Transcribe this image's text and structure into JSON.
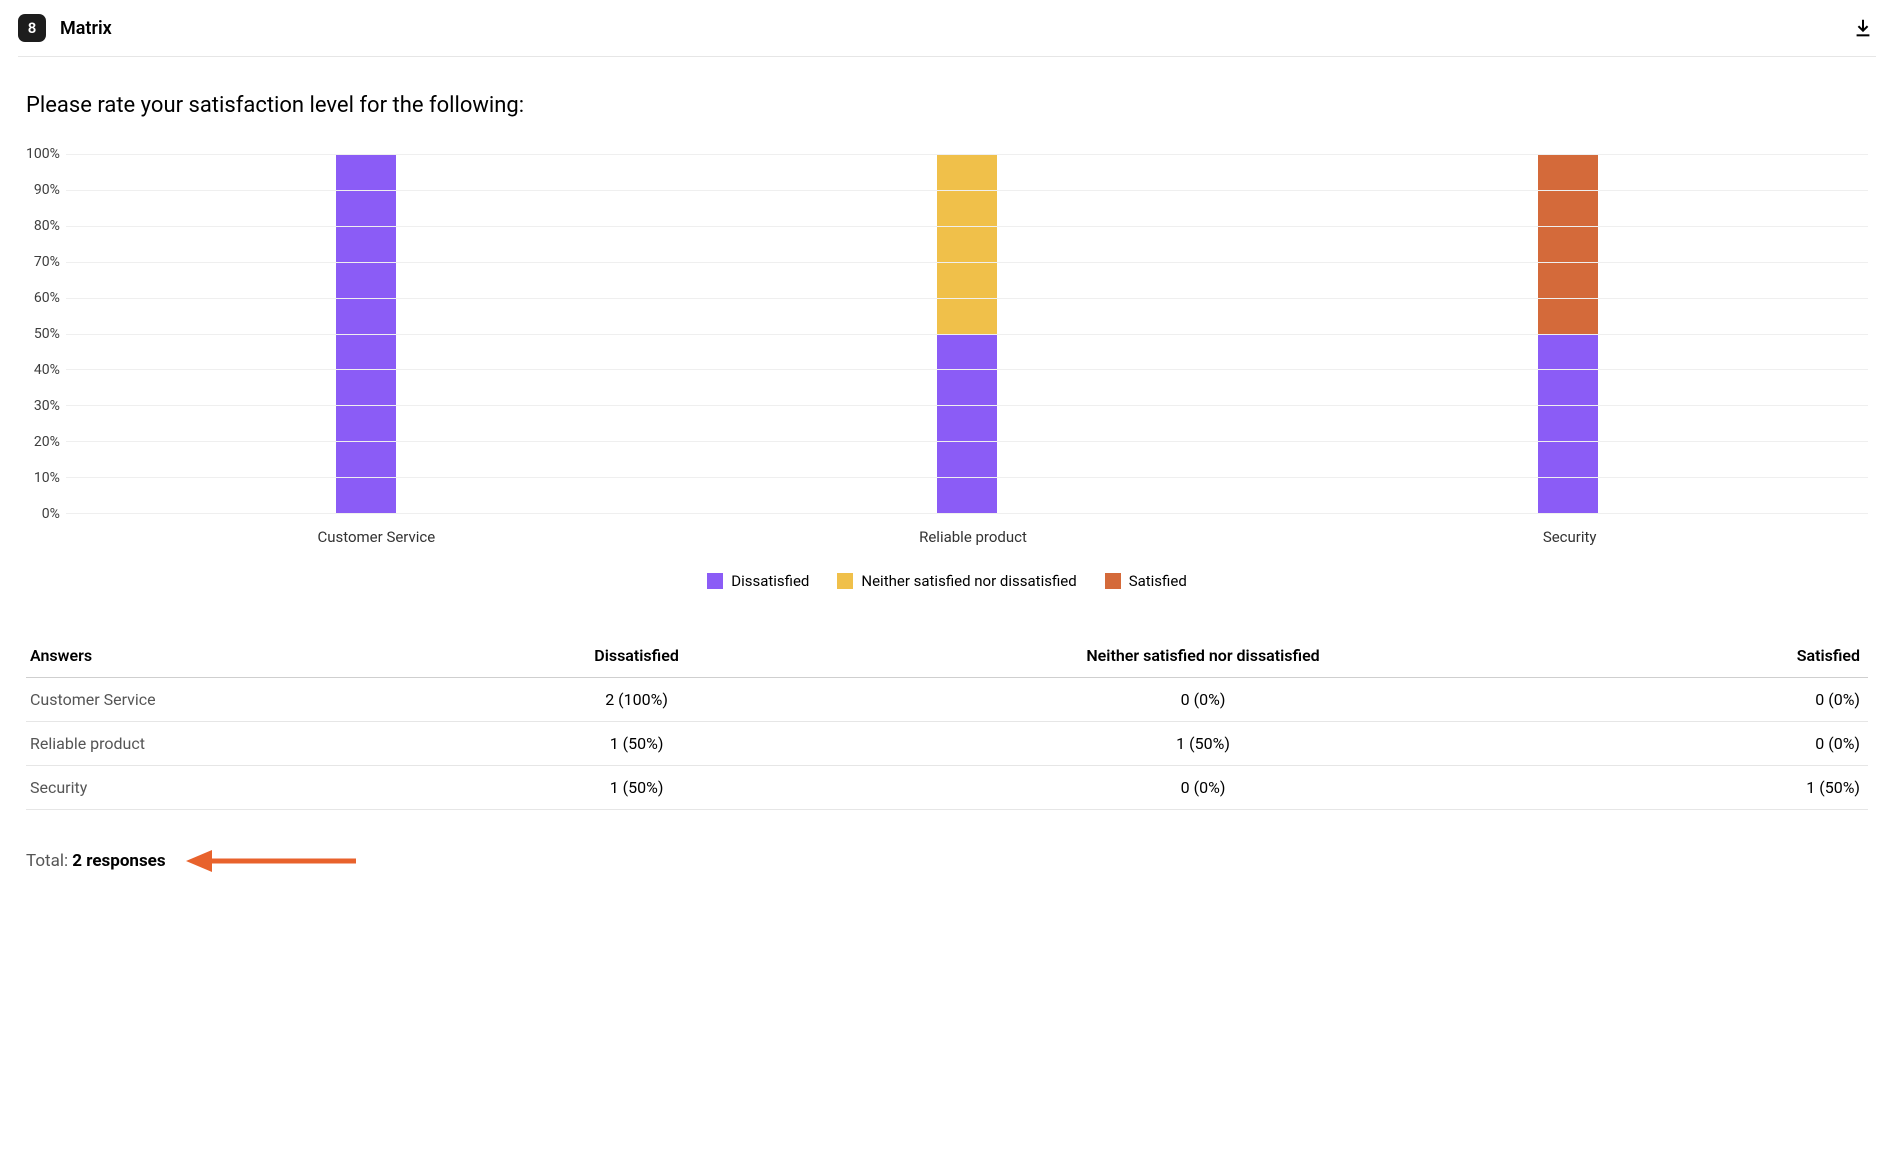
{
  "header": {
    "question_number": "8",
    "question_type": "Matrix"
  },
  "question": {
    "title": "Please rate your satisfaction level for the following:"
  },
  "chart_data": {
    "type": "bar",
    "stacked": true,
    "ylabel": "",
    "xlabel": "",
    "ylim": [
      0,
      100
    ],
    "y_ticks": [
      "100%",
      "90%",
      "80%",
      "70%",
      "60%",
      "50%",
      "40%",
      "30%",
      "20%",
      "10%",
      "0%"
    ],
    "categories": [
      "Customer Service",
      "Reliable product",
      "Security"
    ],
    "series": [
      {
        "name": "Dissatisfied",
        "color": "#8b5cf6",
        "values": [
          100,
          50,
          50
        ]
      },
      {
        "name": "Neither satisfied nor dissatisfied",
        "color": "#f0c04a",
        "values": [
          0,
          50,
          0
        ]
      },
      {
        "name": "Satisfied",
        "color": "#d46a3a",
        "values": [
          0,
          0,
          50
        ]
      }
    ]
  },
  "table": {
    "headers": [
      "Answers",
      "Dissatisfied",
      "Neither satisfied nor dissatisfied",
      "Satisfied"
    ],
    "rows": [
      {
        "label": "Customer Service",
        "cells": [
          "2 (100%)",
          "0 (0%)",
          "0 (0%)"
        ]
      },
      {
        "label": "Reliable product",
        "cells": [
          "1 (50%)",
          "1 (50%)",
          "0 (0%)"
        ]
      },
      {
        "label": "Security",
        "cells": [
          "1 (50%)",
          "0 (0%)",
          "1 (50%)"
        ]
      }
    ]
  },
  "total": {
    "label": "Total:",
    "value": "2 responses"
  },
  "annotation": {
    "arrow_color": "#e8622c"
  }
}
